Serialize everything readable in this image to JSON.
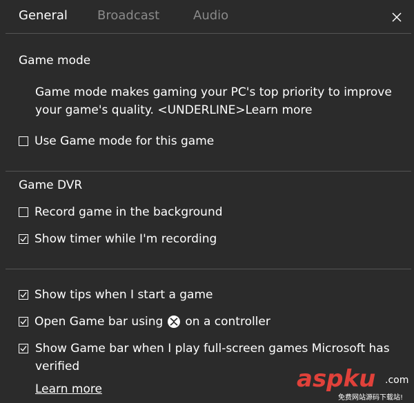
{
  "tabs": [
    {
      "label": "General",
      "active": true
    },
    {
      "label": "Broadcast",
      "active": false
    },
    {
      "label": "Audio",
      "active": false
    }
  ],
  "game_mode": {
    "heading": "Game mode",
    "description": "Game mode makes gaming your PC's top priority to improve your game's quality. <UNDERLINE>Learn more",
    "option": {
      "label": "Use Game mode for this game",
      "checked": false
    }
  },
  "game_dvr": {
    "heading": "Game DVR",
    "options": [
      {
        "label": "Record game in the background",
        "checked": false
      },
      {
        "label": "Show timer while I'm recording",
        "checked": true
      }
    ]
  },
  "general_options": {
    "tips": {
      "label": "Show tips when I start a game",
      "checked": true
    },
    "gamebar_controller": {
      "label_before": "Open Game bar using",
      "label_after": "on a controller",
      "checked": true,
      "icon": "xbox-icon"
    },
    "fullscreen": {
      "label": "Show Game bar when I play full-screen games Microsoft has verified",
      "checked": true
    },
    "learn_more": "Learn more"
  },
  "watermark": {
    "brand": "aspku",
    "domain": ".com",
    "tagline": "免费网站源码下载站!"
  },
  "colors": {
    "background": "#2b2b2b",
    "text": "#ffffff",
    "inactive_tab": "#8a8a8a",
    "divider": "#555555",
    "watermark": "#e0413a"
  }
}
